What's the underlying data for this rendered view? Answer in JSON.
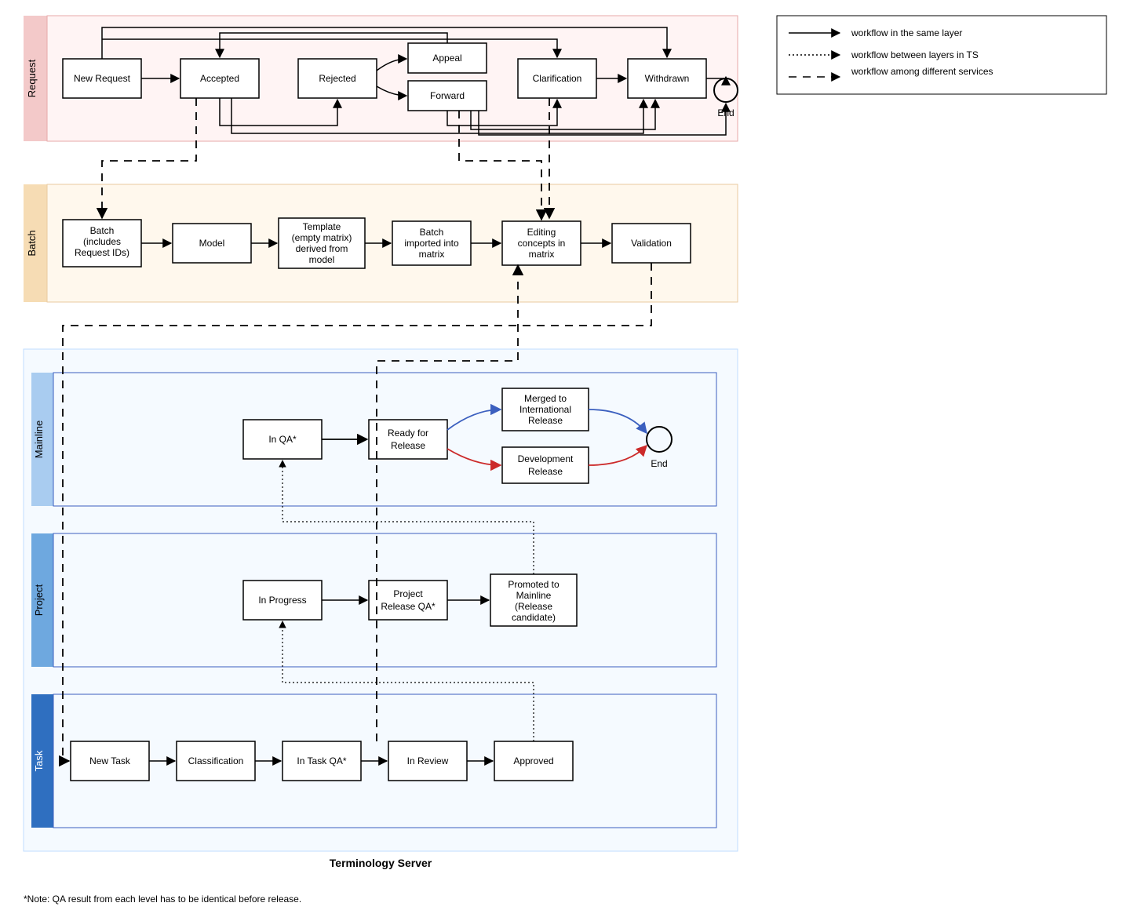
{
  "lanes": {
    "request": "Request",
    "batch": "Batch",
    "mainline": "Mainline",
    "project": "Project",
    "task": "Task"
  },
  "tsLabel": "Terminology Server",
  "footnote": "*Note: QA result from each level has to be identical before release.",
  "legend": {
    "same": "workflow in the same layer",
    "between": "workflow between layers in TS",
    "across": "workflow among different services"
  },
  "request": {
    "newRequest": "New Request",
    "accepted": "Accepted",
    "rejected": "Rejected",
    "appeal": "Appeal",
    "forward": "Forward",
    "clarification": "Clarification",
    "withdrawn": "Withdrawn",
    "end": "End"
  },
  "batch": {
    "batch_l1": "Batch",
    "batch_l2": "(includes",
    "batch_l3": "Request IDs)",
    "model": "Model",
    "template_l1": "Template",
    "template_l2": "(empty matrix)",
    "template_l3": "derived from",
    "template_l4": "model",
    "imported_l1": "Batch",
    "imported_l2": "imported into",
    "imported_l3": "matrix",
    "editing_l1": "Editing",
    "editing_l2": "concepts in",
    "editing_l3": "matrix",
    "validation": "Validation"
  },
  "mainline": {
    "inqa": "In QA*",
    "ready_l1": "Ready for",
    "ready_l2": "Release",
    "merged_l1": "Merged to",
    "merged_l2": "International",
    "merged_l3": "Release",
    "dev_l1": "Development",
    "dev_l2": "Release",
    "end": "End"
  },
  "project": {
    "inprogress": "In Progress",
    "qa_l1": "Project",
    "qa_l2": "Release QA*",
    "promoted_l1": "Promoted to",
    "promoted_l2": "Mainline",
    "promoted_l3": "(Release",
    "promoted_l4": "candidate)"
  },
  "task": {
    "newtask": "New Task",
    "classification": "Classification",
    "intaskqa": "In Task QA*",
    "inreview": "In Review",
    "approved": "Approved"
  }
}
